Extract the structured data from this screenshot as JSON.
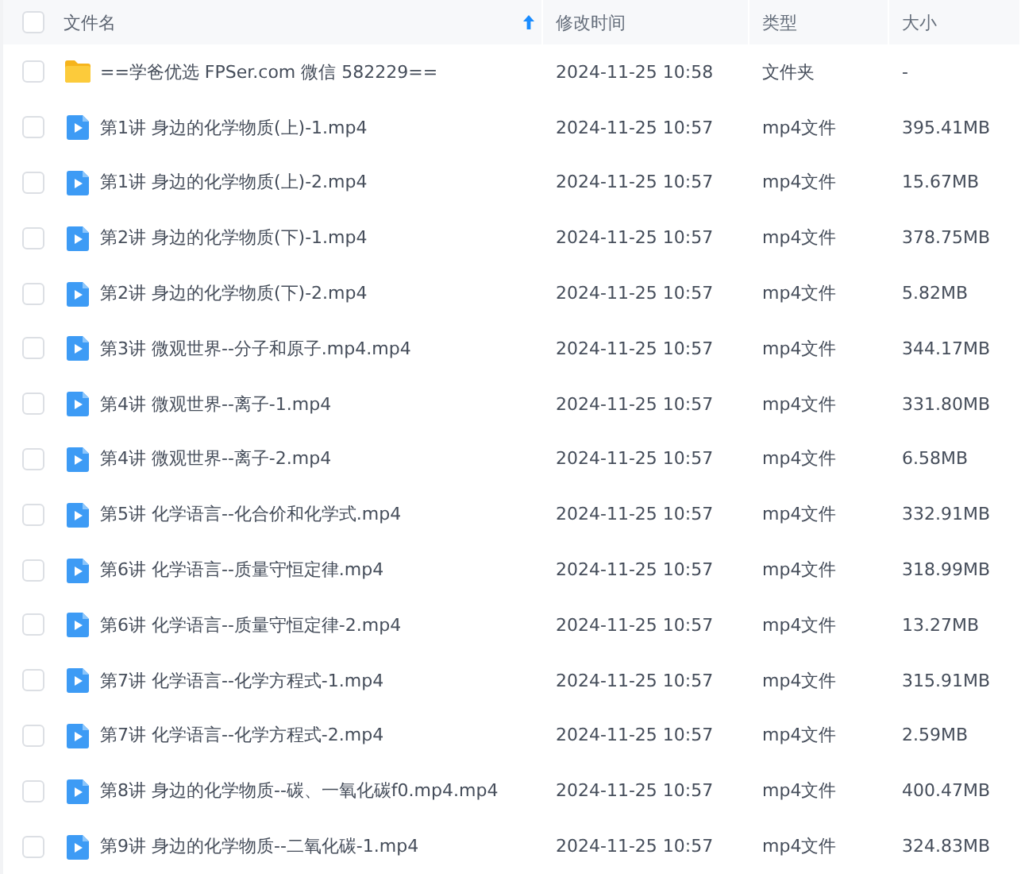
{
  "table": {
    "all_checked": false,
    "columns": [
      {
        "label": "文件名",
        "sorted": true
      },
      {
        "label": "修改时间",
        "sorted": false
      },
      {
        "label": "类型",
        "sorted": false
      },
      {
        "label": "大小",
        "sorted": false
      }
    ],
    "rows": [
      {
        "kind": "folder",
        "checked": false,
        "name": "==学爸优选 FPSer.com 微信 582229==",
        "modified": "2024-11-25 10:58",
        "type": "文件夹",
        "size": "-"
      },
      {
        "kind": "video",
        "checked": false,
        "name": "第1讲 身边的化学物质(上)-1.mp4",
        "modified": "2024-11-25 10:57",
        "type": "mp4文件",
        "size": "395.41MB"
      },
      {
        "kind": "video",
        "checked": false,
        "name": "第1讲 身边的化学物质(上)-2.mp4",
        "modified": "2024-11-25 10:57",
        "type": "mp4文件",
        "size": "15.67MB"
      },
      {
        "kind": "video",
        "checked": false,
        "name": "第2讲 身边的化学物质(下)-1.mp4",
        "modified": "2024-11-25 10:57",
        "type": "mp4文件",
        "size": "378.75MB"
      },
      {
        "kind": "video",
        "checked": false,
        "name": "第2讲 身边的化学物质(下)-2.mp4",
        "modified": "2024-11-25 10:57",
        "type": "mp4文件",
        "size": "5.82MB"
      },
      {
        "kind": "video",
        "checked": false,
        "name": "第3讲 微观世界--分子和原子.mp4.mp4",
        "modified": "2024-11-25 10:57",
        "type": "mp4文件",
        "size": "344.17MB"
      },
      {
        "kind": "video",
        "checked": false,
        "name": "第4讲 微观世界--离子-1.mp4",
        "modified": "2024-11-25 10:57",
        "type": "mp4文件",
        "size": "331.80MB"
      },
      {
        "kind": "video",
        "checked": false,
        "name": "第4讲 微观世界--离子-2.mp4",
        "modified": "2024-11-25 10:57",
        "type": "mp4文件",
        "size": "6.58MB"
      },
      {
        "kind": "video",
        "checked": false,
        "name": "第5讲 化学语言--化合价和化学式.mp4",
        "modified": "2024-11-25 10:57",
        "type": "mp4文件",
        "size": "332.91MB"
      },
      {
        "kind": "video",
        "checked": false,
        "name": "第6讲 化学语言--质量守恒定律.mp4",
        "modified": "2024-11-25 10:57",
        "type": "mp4文件",
        "size": "318.99MB"
      },
      {
        "kind": "video",
        "checked": false,
        "name": "第6讲 化学语言--质量守恒定律-2.mp4",
        "modified": "2024-11-25 10:57",
        "type": "mp4文件",
        "size": "13.27MB"
      },
      {
        "kind": "video",
        "checked": false,
        "name": "第7讲 化学语言--化学方程式-1.mp4",
        "modified": "2024-11-25 10:57",
        "type": "mp4文件",
        "size": "315.91MB"
      },
      {
        "kind": "video",
        "checked": false,
        "name": "第7讲 化学语言--化学方程式-2.mp4",
        "modified": "2024-11-25 10:57",
        "type": "mp4文件",
        "size": "2.59MB"
      },
      {
        "kind": "video",
        "checked": false,
        "name": "第8讲 身边的化学物质--碳、一氧化碳f0.mp4.mp4",
        "modified": "2024-11-25 10:57",
        "type": "mp4文件",
        "size": "400.47MB"
      },
      {
        "kind": "video",
        "checked": false,
        "name": "第9讲 身边的化学物质--二氧化碳-1.mp4",
        "modified": "2024-11-25 10:57",
        "type": "mp4文件",
        "size": "324.83MB"
      }
    ]
  }
}
